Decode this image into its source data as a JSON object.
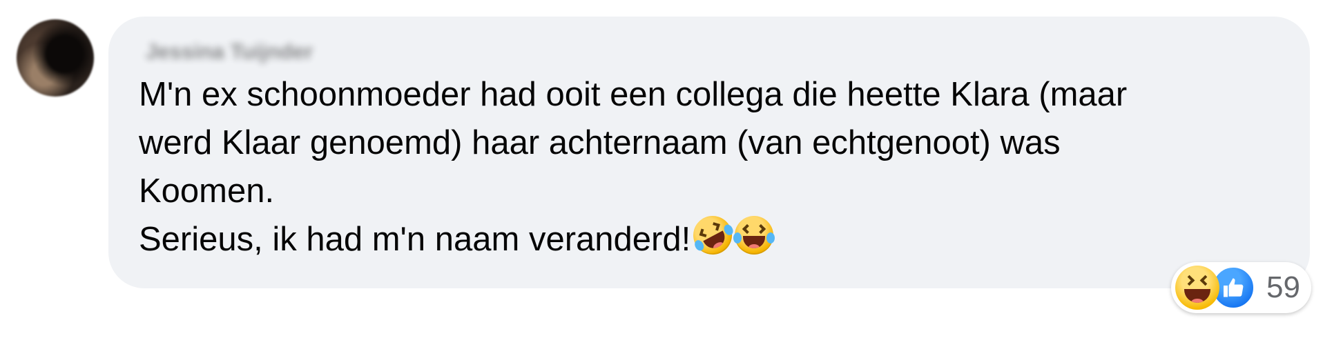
{
  "comment": {
    "author": "Jessina Tuijnder",
    "lines": [
      "M'n ex schoonmoeder had ooit een collega die heette Klara (maar",
      "werd Klaar genoemd) haar achternaam (van echtgenoot) was",
      "Koomen.",
      "Serieus, ik had m'n naam veranderd!"
    ],
    "emojis": [
      "rolling-on-floor-laughing-emoji",
      "face-with-tears-of-joy-emoji"
    ]
  },
  "reactions": {
    "icons": [
      "haha-reaction-icon",
      "like-reaction-icon"
    ],
    "count": "59"
  },
  "colors": {
    "bubble": "#f0f2f5",
    "text": "#050505",
    "like_blue": "#1877f2",
    "count_gray": "#65676b"
  }
}
